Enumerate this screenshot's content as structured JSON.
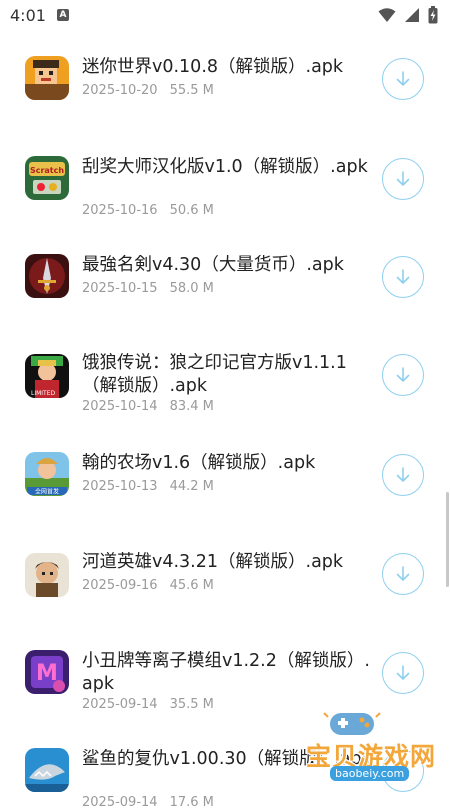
{
  "status_bar": {
    "time": "4:01",
    "notification_icon": "A"
  },
  "accent_color": "#8fd0ef",
  "items": [
    {
      "title": "迷你世界v0.10.8（解锁版）.apk",
      "date": "2025-10-20",
      "size": "55.5 M",
      "icon": "mini-world-icon"
    },
    {
      "title": "刮奖大师汉化版v1.0（解锁版）.apk",
      "date": "2025-10-16",
      "size": "50.6 M",
      "icon": "scratch-master-icon"
    },
    {
      "title": "最強名剣v4.30（大量货币）.apk",
      "date": "2025-10-15",
      "size": "58.0 M",
      "icon": "strongest-sword-icon"
    },
    {
      "title": "饿狼传说：狼之印记官方版v1.1.1（解锁版）.apk",
      "date": "2025-10-14",
      "size": "83.4 M",
      "icon": "fatal-fury-icon"
    },
    {
      "title": "翰的农场v1.6（解锁版）.apk",
      "date": "2025-10-13",
      "size": "44.2 M",
      "icon": "farm-icon"
    },
    {
      "title": "河道英雄v4.3.21（解锁版）.apk",
      "date": "2025-09-16",
      "size": "45.6 M",
      "icon": "river-hero-icon"
    },
    {
      "title": "小丑牌等离子模组v1.2.2（解锁版）.apk",
      "date": "2025-09-14",
      "size": "35.5 M",
      "icon": "balatro-mod-icon"
    },
    {
      "title": "鲨鱼的复仇v1.00.30（解锁版）.apk",
      "date": "2025-09-14",
      "size": "17.6 M",
      "icon": "shark-revenge-icon"
    }
  ],
  "watermark": {
    "text": "宝贝游戏网",
    "url": "baobeiy.com"
  }
}
